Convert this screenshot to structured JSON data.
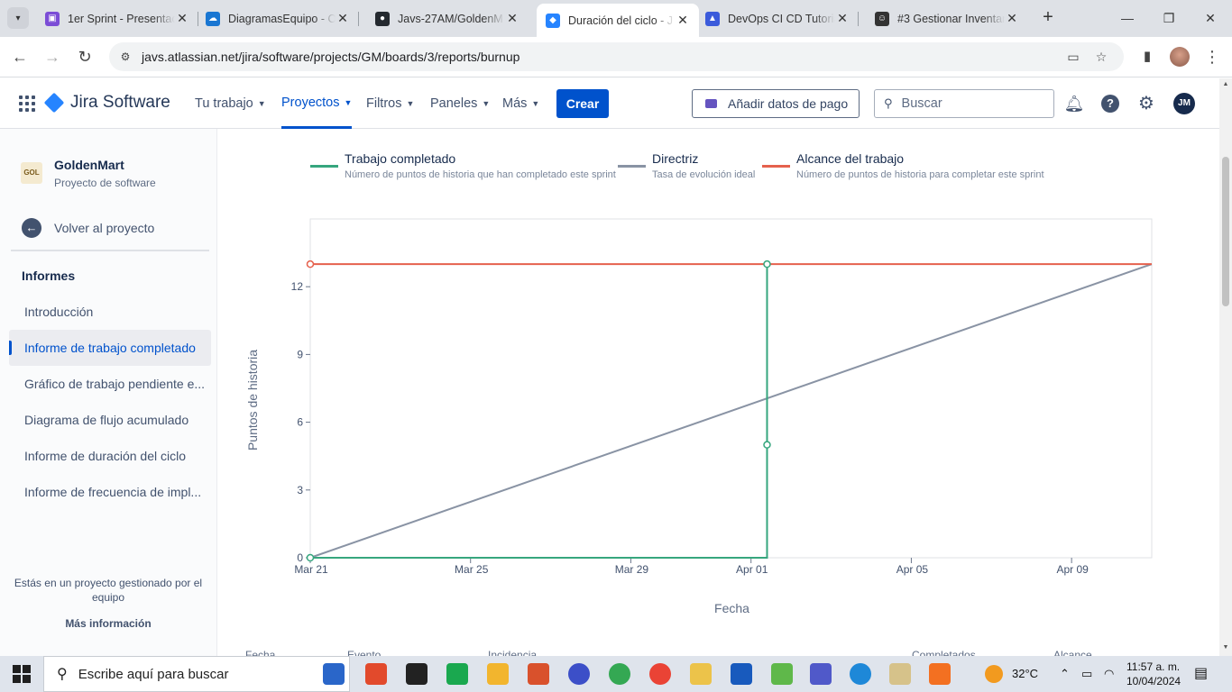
{
  "browser": {
    "tabs": [
      {
        "title": "1er Sprint - Presentac",
        "color": "#7b4dd6",
        "glyph": "▣"
      },
      {
        "title": "DiagramasEquipo - O",
        "color": "#1976d2",
        "glyph": "☁"
      },
      {
        "title": "Javs-27AM/GoldenM",
        "color": "#24292f",
        "glyph": "●"
      },
      {
        "title": "Duración del ciclo - J",
        "color": "#2684ff",
        "glyph": "◆"
      },
      {
        "title": "DevOps CI CD Tutoria",
        "color": "#3b5bdb",
        "glyph": "▲"
      },
      {
        "title": "#3 Gestionar Inventar",
        "color": "#333333",
        "glyph": "☺"
      }
    ],
    "active_tab": 3,
    "url": "javs.atlassian.net/jira/software/projects/GM/boards/3/reports/burnup"
  },
  "jira_nav": {
    "product": "Jira Software",
    "menus": [
      "Tu trabajo",
      "Proyectos",
      "Filtros",
      "Paneles",
      "Más"
    ],
    "active_menu": 1,
    "create_label": "Crear",
    "pay_label": "Añadir datos de pago",
    "search_placeholder": "Buscar",
    "user_initials": "JM"
  },
  "sidebar": {
    "project_logo_text": "GOL",
    "project_name": "GoldenMart",
    "project_type": "Proyecto de software",
    "back_label": "Volver al proyecto",
    "heading": "Informes",
    "items": [
      {
        "label": "Introducción"
      },
      {
        "label": "Informe de trabajo completado"
      },
      {
        "label": "Gráfico de trabajo pendiente e..."
      },
      {
        "label": "Diagrama de flujo acumulado"
      },
      {
        "label": "Informe de duración del ciclo"
      },
      {
        "label": "Informe de frecuencia de impl..."
      }
    ],
    "active_index": 1,
    "footer_text": "Estás en un proyecto gestionado por el equipo",
    "more_info": "Más información"
  },
  "legend": [
    {
      "title": "Trabajo completado",
      "desc": "Número de puntos de historia que han completado este sprint",
      "color": "#36a67e"
    },
    {
      "title": "Directriz",
      "desc": "Tasa de evolución ideal",
      "color": "#8993a4"
    },
    {
      "title": "Alcance del trabajo",
      "desc": "Número de puntos de historia para completar este sprint",
      "color": "#e5614d"
    }
  ],
  "chart_data": {
    "type": "line",
    "xlabel": "Fecha",
    "ylabel": "Puntos de historia",
    "x_ticks": [
      "Mar 21",
      "Mar 25",
      "Mar 29",
      "Apr 01",
      "Apr 05",
      "Apr 09"
    ],
    "x_tick_days": [
      0,
      4,
      8,
      11,
      15,
      19
    ],
    "x_range_days": [
      0,
      21
    ],
    "y_ticks": [
      0,
      3,
      6,
      9,
      12
    ],
    "ylim": [
      0,
      15
    ],
    "series": [
      {
        "name": "Trabajo completado",
        "color": "#36a67e",
        "step": true,
        "points": [
          [
            0,
            0
          ],
          [
            11.4,
            0
          ],
          [
            11.4,
            5
          ],
          [
            11.4,
            13
          ]
        ],
        "markers": [
          [
            0,
            0
          ],
          [
            11.4,
            5
          ],
          [
            11.4,
            13
          ]
        ]
      },
      {
        "name": "Directriz",
        "color": "#8993a4",
        "step": false,
        "points": [
          [
            0,
            0
          ],
          [
            21,
            13
          ]
        ],
        "markers": []
      },
      {
        "name": "Alcance del trabajo",
        "color": "#e5614d",
        "step": false,
        "points": [
          [
            0,
            13
          ],
          [
            21,
            13
          ]
        ],
        "markers": [
          [
            0,
            13
          ]
        ]
      }
    ]
  },
  "table_headers": [
    "Fecha",
    "Evento",
    "Incidencia",
    "Completados",
    "Alcance"
  ],
  "taskbar": {
    "search_placeholder": "Escribe aquí para buscar",
    "temperature": "32°C",
    "time": "11:57 a. m.",
    "date": "10/04/2024"
  }
}
